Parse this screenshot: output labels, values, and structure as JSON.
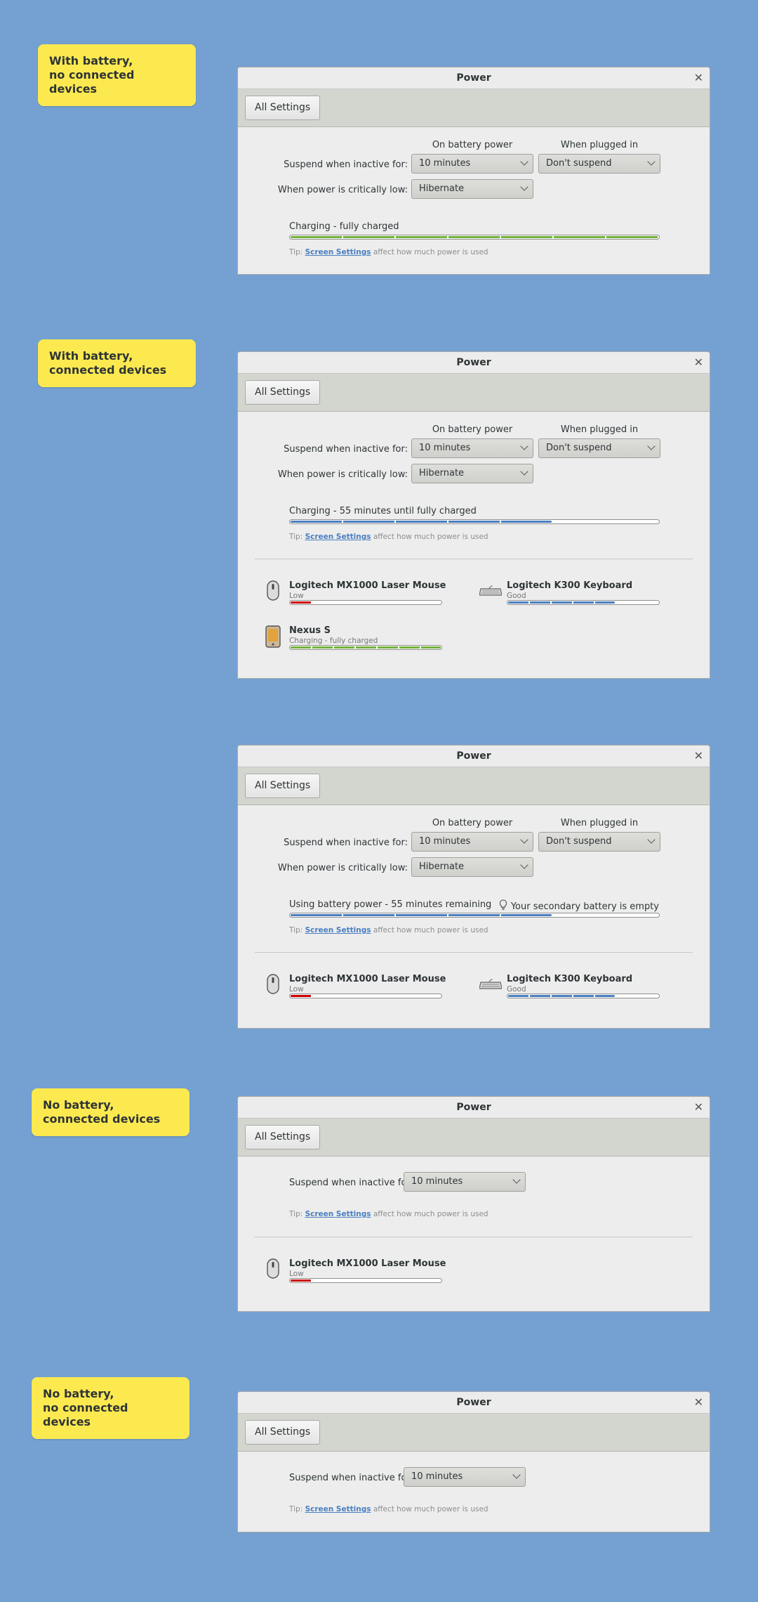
{
  "colors": {
    "background": "#74a1d2",
    "note": "#fce94f",
    "green": "#73b33a",
    "blue": "#4a7fc1",
    "red": "#cc0000"
  },
  "common": {
    "title": "Power",
    "close_icon": "close-icon",
    "all_settings": "All Settings",
    "header_battery": "On battery power",
    "header_plugged": "When plugged in",
    "suspend_label": "Suspend when inactive for:",
    "critical_label": "When power is critically low:",
    "suspend_battery": "10 minutes",
    "suspend_plugged": "Don't suspend",
    "critical_value": "Hibernate",
    "tip_prefix": "Tip:",
    "tip_link": "Screen Settings",
    "tip_suffix": "affect how much power is used"
  },
  "notes": {
    "n1": "With battery,\nno connected devices",
    "n2": "With battery,\nconnected devices",
    "n3": "No battery,\nconnected devices",
    "n4": "No battery,\nno connected devices"
  },
  "mockups": [
    {
      "battery_text": "Charging - fully charged",
      "battery_level": 1.0,
      "battery_color": "green"
    },
    {
      "battery_text": "Charging - 55 minutes until fully charged",
      "battery_level": 0.71,
      "battery_color": "blue",
      "devices": [
        {
          "name": "Logitech MX1000 Laser Mouse",
          "status": "Low",
          "level": 0.14,
          "color": "red",
          "icon": "mouse-icon"
        },
        {
          "name": "Logitech K300 Keyboard",
          "status": "Good",
          "level": 0.71,
          "color": "blue",
          "icon": "keyboard-icon"
        },
        {
          "name": "Nexus S",
          "status": "Charging - fully charged",
          "level": 1.0,
          "color": "green",
          "icon": "phone-icon"
        }
      ]
    },
    {
      "battery_text": "Using battery power - 55 minutes remaining",
      "battery_level": 0.71,
      "battery_color": "blue",
      "warning": "Your secondary battery is empty",
      "warning_icon": "lightbulb-icon",
      "devices": [
        {
          "name": "Logitech MX1000 Laser Mouse",
          "status": "Low",
          "level": 0.14,
          "color": "red",
          "icon": "mouse-icon"
        },
        {
          "name": "Logitech K300 Keyboard",
          "status": "Good",
          "level": 0.71,
          "color": "blue",
          "icon": "keyboard-icon"
        }
      ]
    },
    {
      "devices": [
        {
          "name": "Logitech MX1000 Laser Mouse",
          "status": "Low",
          "level": 0.14,
          "color": "red",
          "icon": "mouse-icon"
        }
      ]
    },
    {}
  ]
}
